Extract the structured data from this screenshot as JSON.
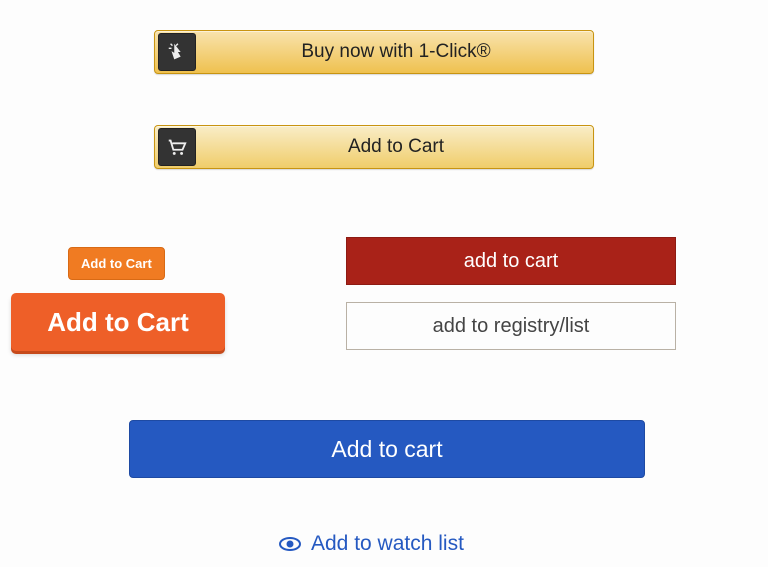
{
  "amazon": {
    "buy_now_label": "Buy now with 1-Click®",
    "add_to_cart_label": "Add to Cart"
  },
  "small_orange_label": "Add to Cart",
  "large_orange_label": "Add to Cart",
  "dark_red_label": "add to cart",
  "registry_label": "add to registry/list",
  "big_blue_label": "Add to cart",
  "watch_list_label": "Add to watch list",
  "colors": {
    "amazon_gradient_top": "#f8e3ad",
    "amazon_gradient_bottom": "#efc14f",
    "orange_small": "#f07b22",
    "orange_large": "#ee5f28",
    "dark_red": "#a92218",
    "blue": "#2559c1"
  }
}
